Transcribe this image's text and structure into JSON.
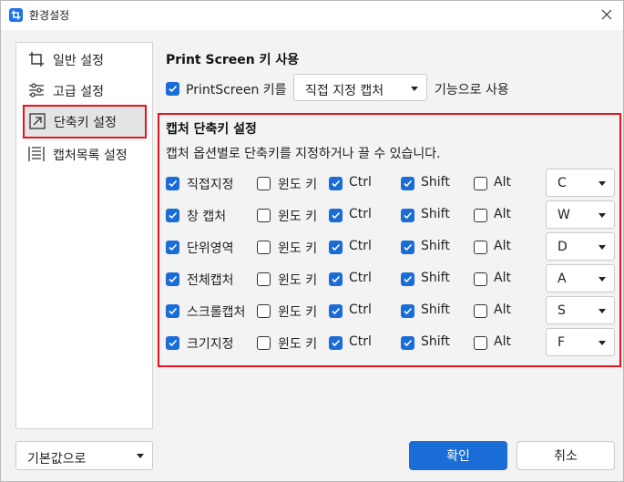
{
  "window": {
    "title": "환경설정"
  },
  "sidebar": {
    "items": [
      {
        "label": "일반 설정",
        "icon": "crop-icon",
        "active": false
      },
      {
        "label": "고급 설정",
        "icon": "sliders-icon",
        "active": false
      },
      {
        "label": "단축키 설정",
        "icon": "arrow-box-icon",
        "active": true
      },
      {
        "label": "캡처목록 설정",
        "icon": "list-icon",
        "active": false
      }
    ],
    "preset": {
      "value": "기본값으로"
    }
  },
  "printscreen": {
    "title": "Print Screen 키 사용",
    "checkbox_label": "PrintScreen 키를",
    "checked": true,
    "select_value": "직접 지정 캡처",
    "suffix": "기능으로 사용"
  },
  "shortcuts": {
    "title": "캡처 단축키 설정",
    "description": "캡처 옵션별로 단축키를 지정하거나 끌 수 있습니다.",
    "modifier_labels": {
      "win": "윈도 키",
      "ctrl": "Ctrl",
      "shift": "Shift",
      "alt": "Alt"
    },
    "rows": [
      {
        "name": "직접지정",
        "enabled": true,
        "win": false,
        "ctrl": true,
        "shift": true,
        "alt": false,
        "key": "C"
      },
      {
        "name": "창 캡처",
        "enabled": true,
        "win": false,
        "ctrl": true,
        "shift": true,
        "alt": false,
        "key": "W"
      },
      {
        "name": "단위영역",
        "enabled": true,
        "win": false,
        "ctrl": true,
        "shift": true,
        "alt": false,
        "key": "D"
      },
      {
        "name": "전체캡처",
        "enabled": true,
        "win": false,
        "ctrl": true,
        "shift": true,
        "alt": false,
        "key": "A"
      },
      {
        "name": "스크롤캡처",
        "enabled": true,
        "win": false,
        "ctrl": true,
        "shift": true,
        "alt": false,
        "key": "S"
      },
      {
        "name": "크기지정",
        "enabled": true,
        "win": false,
        "ctrl": true,
        "shift": true,
        "alt": false,
        "key": "F"
      }
    ]
  },
  "buttons": {
    "ok": "확인",
    "cancel": "취소"
  },
  "colors": {
    "accent": "#1a6dd6",
    "highlight": "#e8141c"
  }
}
